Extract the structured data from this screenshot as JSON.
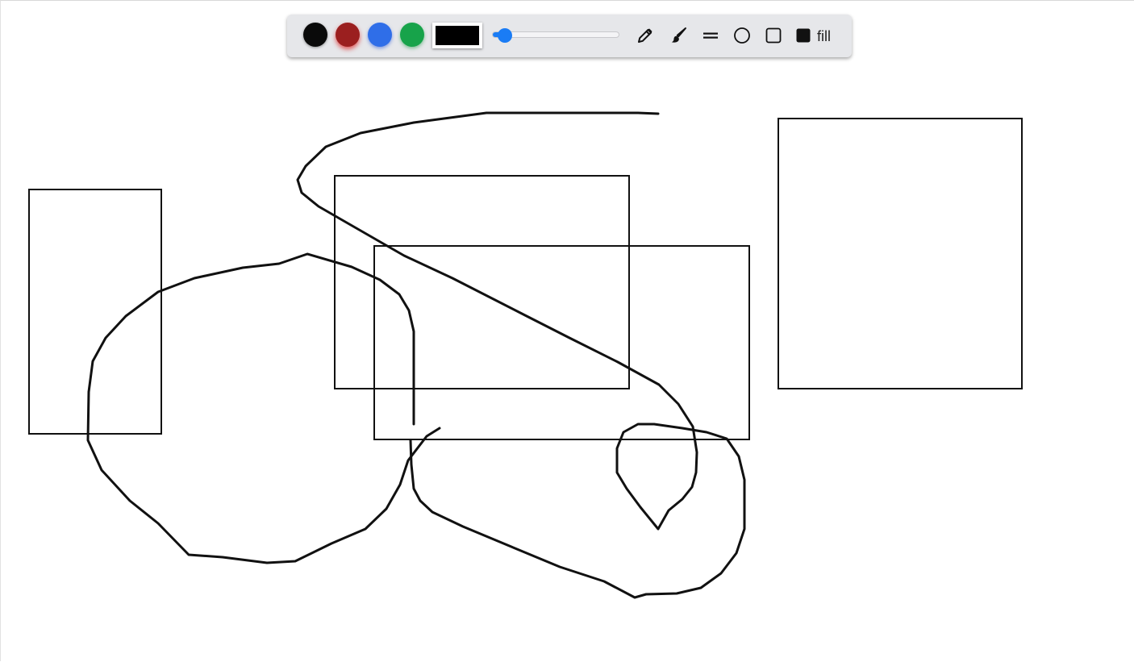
{
  "toolbar": {
    "swatches": [
      {
        "name": "black",
        "color": "#0a0a0a"
      },
      {
        "name": "red",
        "color": "#9b1f1f"
      },
      {
        "name": "blue",
        "color": "#2f6ee8"
      },
      {
        "name": "green",
        "color": "#17a34a"
      }
    ],
    "current_color": "#000000",
    "stroke_width_fraction": 0.05,
    "tools": [
      "pencil-icon",
      "brush-icon",
      "line-icon",
      "circle-icon",
      "square-icon",
      "fill-square-icon"
    ],
    "fill_label": "fill"
  },
  "canvas": {
    "background": "#ffffff",
    "stroke_color": "#111111",
    "shapes": [
      "rectangle",
      "rectangle",
      "rectangle",
      "rectangle",
      "freehand-stroke",
      "freehand-stroke"
    ]
  }
}
